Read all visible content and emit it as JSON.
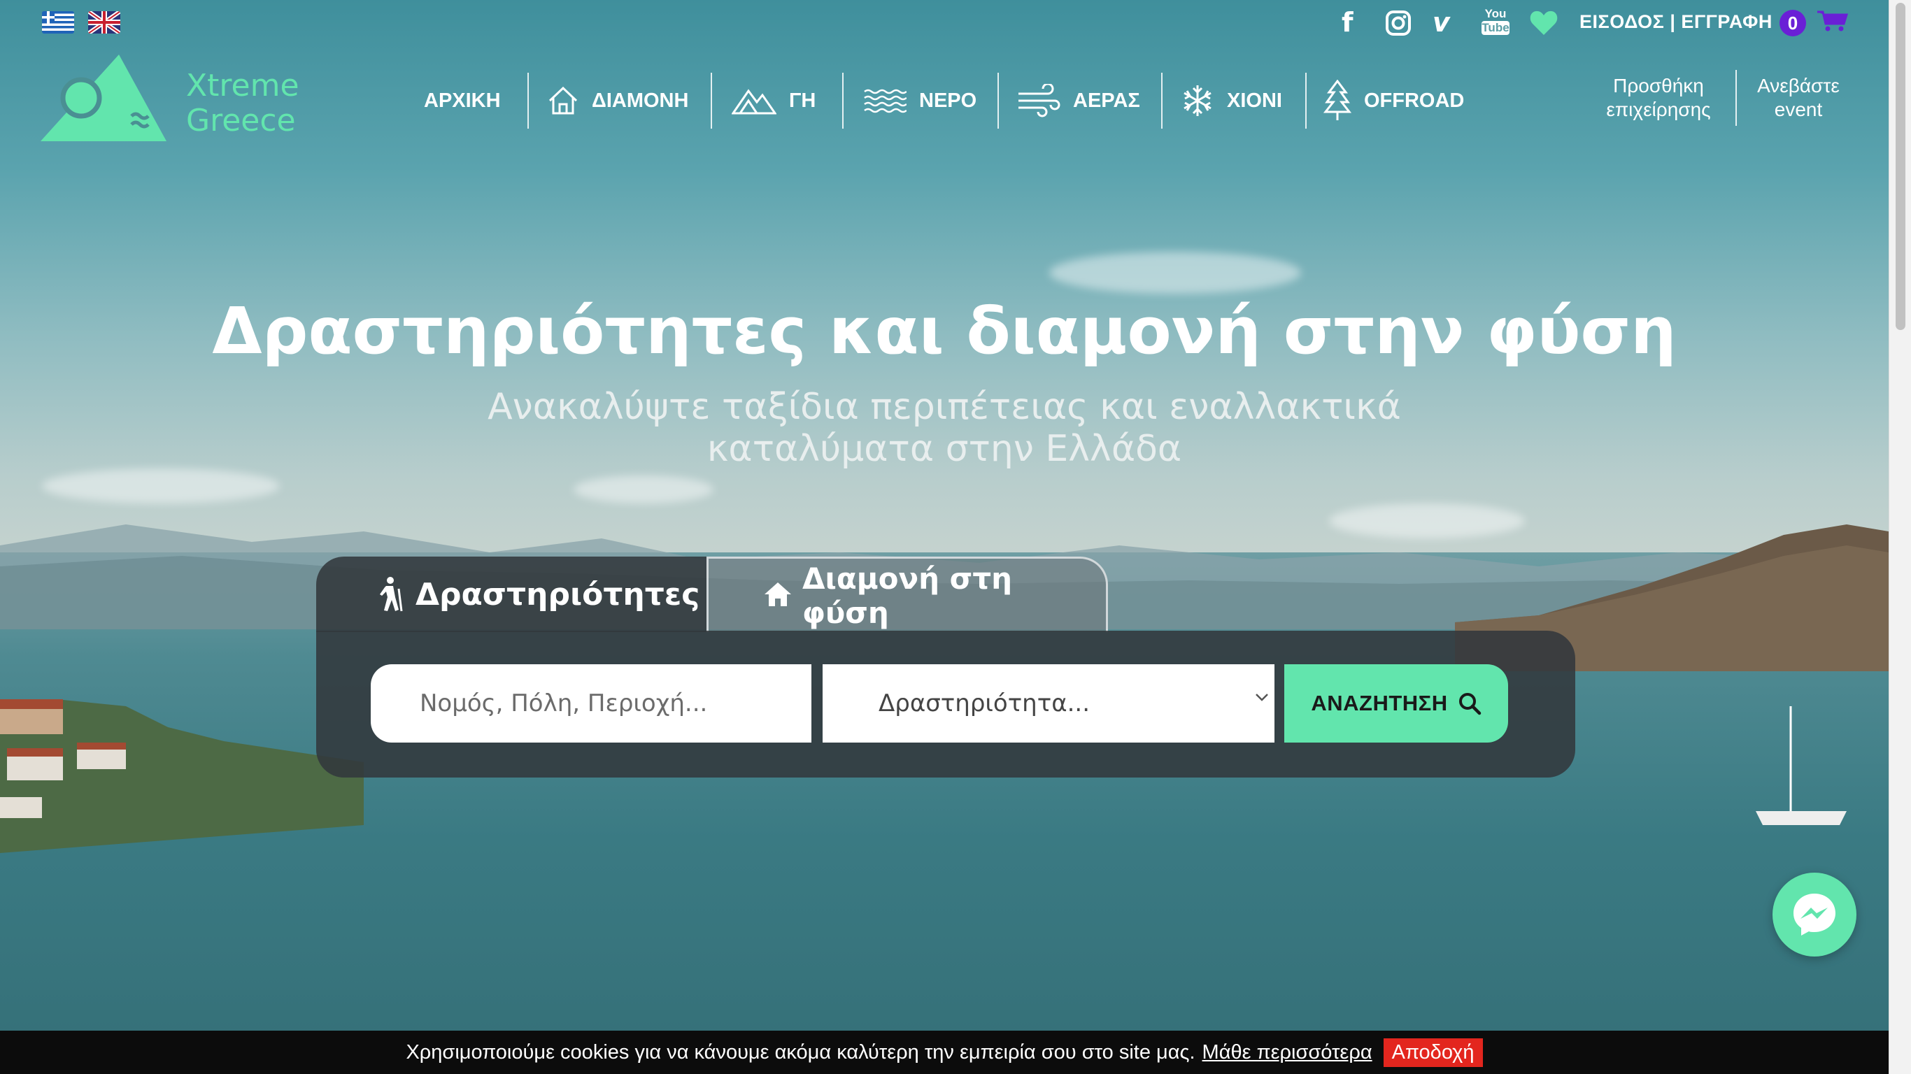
{
  "languages": [
    {
      "code": "el",
      "icon": "greek-flag-icon"
    },
    {
      "code": "en",
      "icon": "uk-flag-icon"
    }
  ],
  "social": [
    {
      "name": "facebook",
      "icon": "facebook-icon",
      "glyph": "f"
    },
    {
      "name": "instagram",
      "icon": "instagram-icon"
    },
    {
      "name": "vimeo",
      "icon": "vimeo-icon",
      "glyph": "v"
    },
    {
      "name": "youtube",
      "icon": "youtube-icon",
      "glyph_top": "You",
      "glyph_bottom": "Tube"
    }
  ],
  "topbar": {
    "login_label": "ΕΙΣΟΔΟΣ | ΕΓΓΡΑΦΗ",
    "cart_count": "0"
  },
  "logo": {
    "line1": "Xtreme",
    "line2": "Greece"
  },
  "nav": {
    "items": [
      {
        "label": "ΑΡΧΙΚΗ",
        "icon": ""
      },
      {
        "label": "ΔΙΑΜΟΝΗ",
        "icon": "house-icon"
      },
      {
        "label": "ΓΗ",
        "icon": "mountain-icon"
      },
      {
        "label": "ΝΕΡΟ",
        "icon": "waves-icon"
      },
      {
        "label": "ΑΕΡΑΣ",
        "icon": "wind-icon"
      },
      {
        "label": "ΧΙΟΝΙ",
        "icon": "snowflake-icon"
      },
      {
        "label": "OFFROAD",
        "icon": "tree-icon"
      }
    ],
    "add_business_line1": "Προσθήκη",
    "add_business_line2": "επιχείρησης",
    "upload_event_line1": "Ανεβάστε",
    "upload_event_line2": "event"
  },
  "hero": {
    "title": "Δραστηριότητες και διαμονή στην φύση",
    "subtitle": "Ανακαλύψτε ταξίδια περιπέτειας και εναλλακτικά καταλύματα στην Ελλάδα"
  },
  "search": {
    "tabs": [
      {
        "label": "Δραστηριότητες",
        "icon": "hiker-icon",
        "active": true
      },
      {
        "label": "Διαμονή στη φύση",
        "icon": "home-icon",
        "active": false
      }
    ],
    "location_placeholder": "Νομός, Πόλη, Περιοχή...",
    "activity_selected": "Δραστηριότητα...",
    "button_label": "ΑΝΑΖΗΤΗΣΗ"
  },
  "cookie": {
    "text": "Χρησιμοποιούμε cookies για να κάνουμε ακόμα καλύτερη την εμπειρία σου στο site μας.",
    "learn_more": "Μάθε περισσότερα",
    "accept": "Αποδοχή"
  },
  "colors": {
    "accent": "#62e5ad",
    "cart_badge": "#6a1fd6",
    "cookie_accept": "#e3261e",
    "panel": "#32383c"
  }
}
